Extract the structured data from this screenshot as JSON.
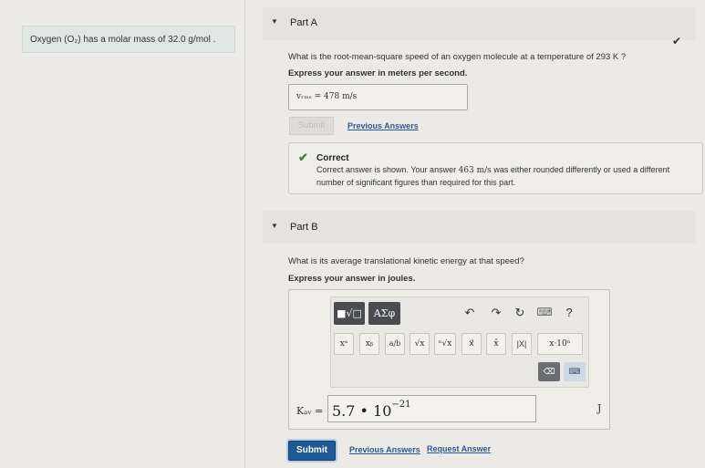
{
  "problem": {
    "statement": "Oxygen (O₂) has a molar mass of 32.0 g/mol ."
  },
  "partA": {
    "title": "Part A",
    "caret_icon": "triangle-down",
    "question": "What is the root-mean-square speed of an oxygen molecule at a temperature of 293 K ?",
    "instruction": "Express your answer in meters per second.",
    "answer_text": "vᵣₘₛ = 478 m/s",
    "submit_label": "Submit",
    "previous_answers_label": "Previous Answers",
    "feedback": {
      "title": "Correct",
      "body_prefix": "Correct answer is shown. Your answer ",
      "body_value": "463 m/s",
      "body_suffix": " was either rounded differently or used a different number of significant figures than required for this part."
    }
  },
  "partB": {
    "title": "Part B",
    "question": "What is its average translational kinetic energy at that speed?",
    "instruction": "Express your answer in joules.",
    "toolbar": {
      "template_label": "■√□",
      "greek_label": "ΑΣφ",
      "undo": "↶",
      "redo": "↷",
      "reset": "↻",
      "keyboard": "⌨",
      "help": "?",
      "superscript": "xᵃ",
      "subscript": "xᵦ",
      "fraction": "a/b",
      "sqrt": "√x",
      "nthroot": "ⁿ√x",
      "vector": "x⃗",
      "unitvector": "x̂",
      "abs": "|X|",
      "scientific": "x·10ⁿ",
      "backspace": "⌫",
      "keypad": "⌨"
    },
    "answer_label": "Kₐᵥ =",
    "answer_value": "5.7 • 10",
    "answer_exponent": "−21",
    "unit": "J",
    "submit_label": "Submit",
    "previous_answers_label": "Previous Answers",
    "request_answer_label": "Request Answer"
  },
  "colors": {
    "submit_bg": "#1e5a96",
    "correct_green": "#3d8a2e",
    "link_blue": "#2b5a93"
  }
}
